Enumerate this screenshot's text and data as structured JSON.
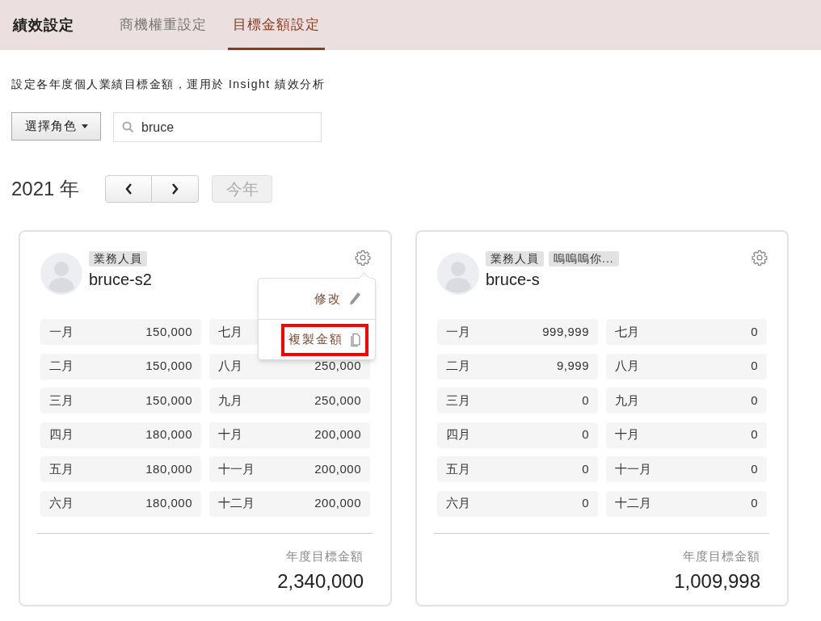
{
  "header": {
    "title": "績效設定",
    "tabs": [
      {
        "label": "商機權重設定",
        "selected": false
      },
      {
        "label": "目標金額設定",
        "selected": true
      }
    ]
  },
  "description": "設定各年度個人業績目標金額，運用於 Insight 績效分析",
  "role_filter": {
    "label": "選擇角色"
  },
  "search": {
    "value": "bruce"
  },
  "year": {
    "label": "2021 年",
    "today_button": {
      "label": "今年",
      "disabled": true
    }
  },
  "cards": [
    {
      "tags": [
        "業務人員"
      ],
      "name": "bruce-s2",
      "months": [
        {
          "label": "一月",
          "value": "150,000"
        },
        {
          "label": "二月",
          "value": "150,000"
        },
        {
          "label": "三月",
          "value": "150,000"
        },
        {
          "label": "四月",
          "value": "180,000"
        },
        {
          "label": "五月",
          "value": "180,000"
        },
        {
          "label": "六月",
          "value": "180,000"
        },
        {
          "label": "七月"
        },
        {
          "label": "八月",
          "value": "250,000"
        },
        {
          "label": "九月",
          "value": "250,000"
        },
        {
          "label": "十月",
          "value": "200,000"
        },
        {
          "label": "十一月",
          "value": "200,000"
        },
        {
          "label": "十二月",
          "value": "200,000"
        }
      ],
      "total_label": "年度目標金額",
      "total": "2,340,000",
      "menu": {
        "items": [
          {
            "label": "修改",
            "kind": "edit",
            "highlighted": false
          },
          {
            "label": "複製金額",
            "kind": "copy",
            "highlighted": true
          }
        ]
      }
    },
    {
      "tags": [
        "業務人員",
        "嗚嗚嗚你..."
      ],
      "name": "bruce-s",
      "months": [
        {
          "label": "一月",
          "value": "999,999"
        },
        {
          "label": "二月",
          "value": "9,999"
        },
        {
          "label": "三月",
          "value": "0"
        },
        {
          "label": "四月",
          "value": "0"
        },
        {
          "label": "五月",
          "value": "0"
        },
        {
          "label": "六月",
          "value": "0"
        },
        {
          "label": "七月",
          "value": "0"
        },
        {
          "label": "八月",
          "value": "0"
        },
        {
          "label": "九月",
          "value": "0"
        },
        {
          "label": "十月",
          "value": "0"
        },
        {
          "label": "十一月",
          "value": "0"
        },
        {
          "label": "十二月",
          "value": "0"
        }
      ],
      "total_label": "年度目標金額",
      "total": "1,009,998"
    }
  ]
}
